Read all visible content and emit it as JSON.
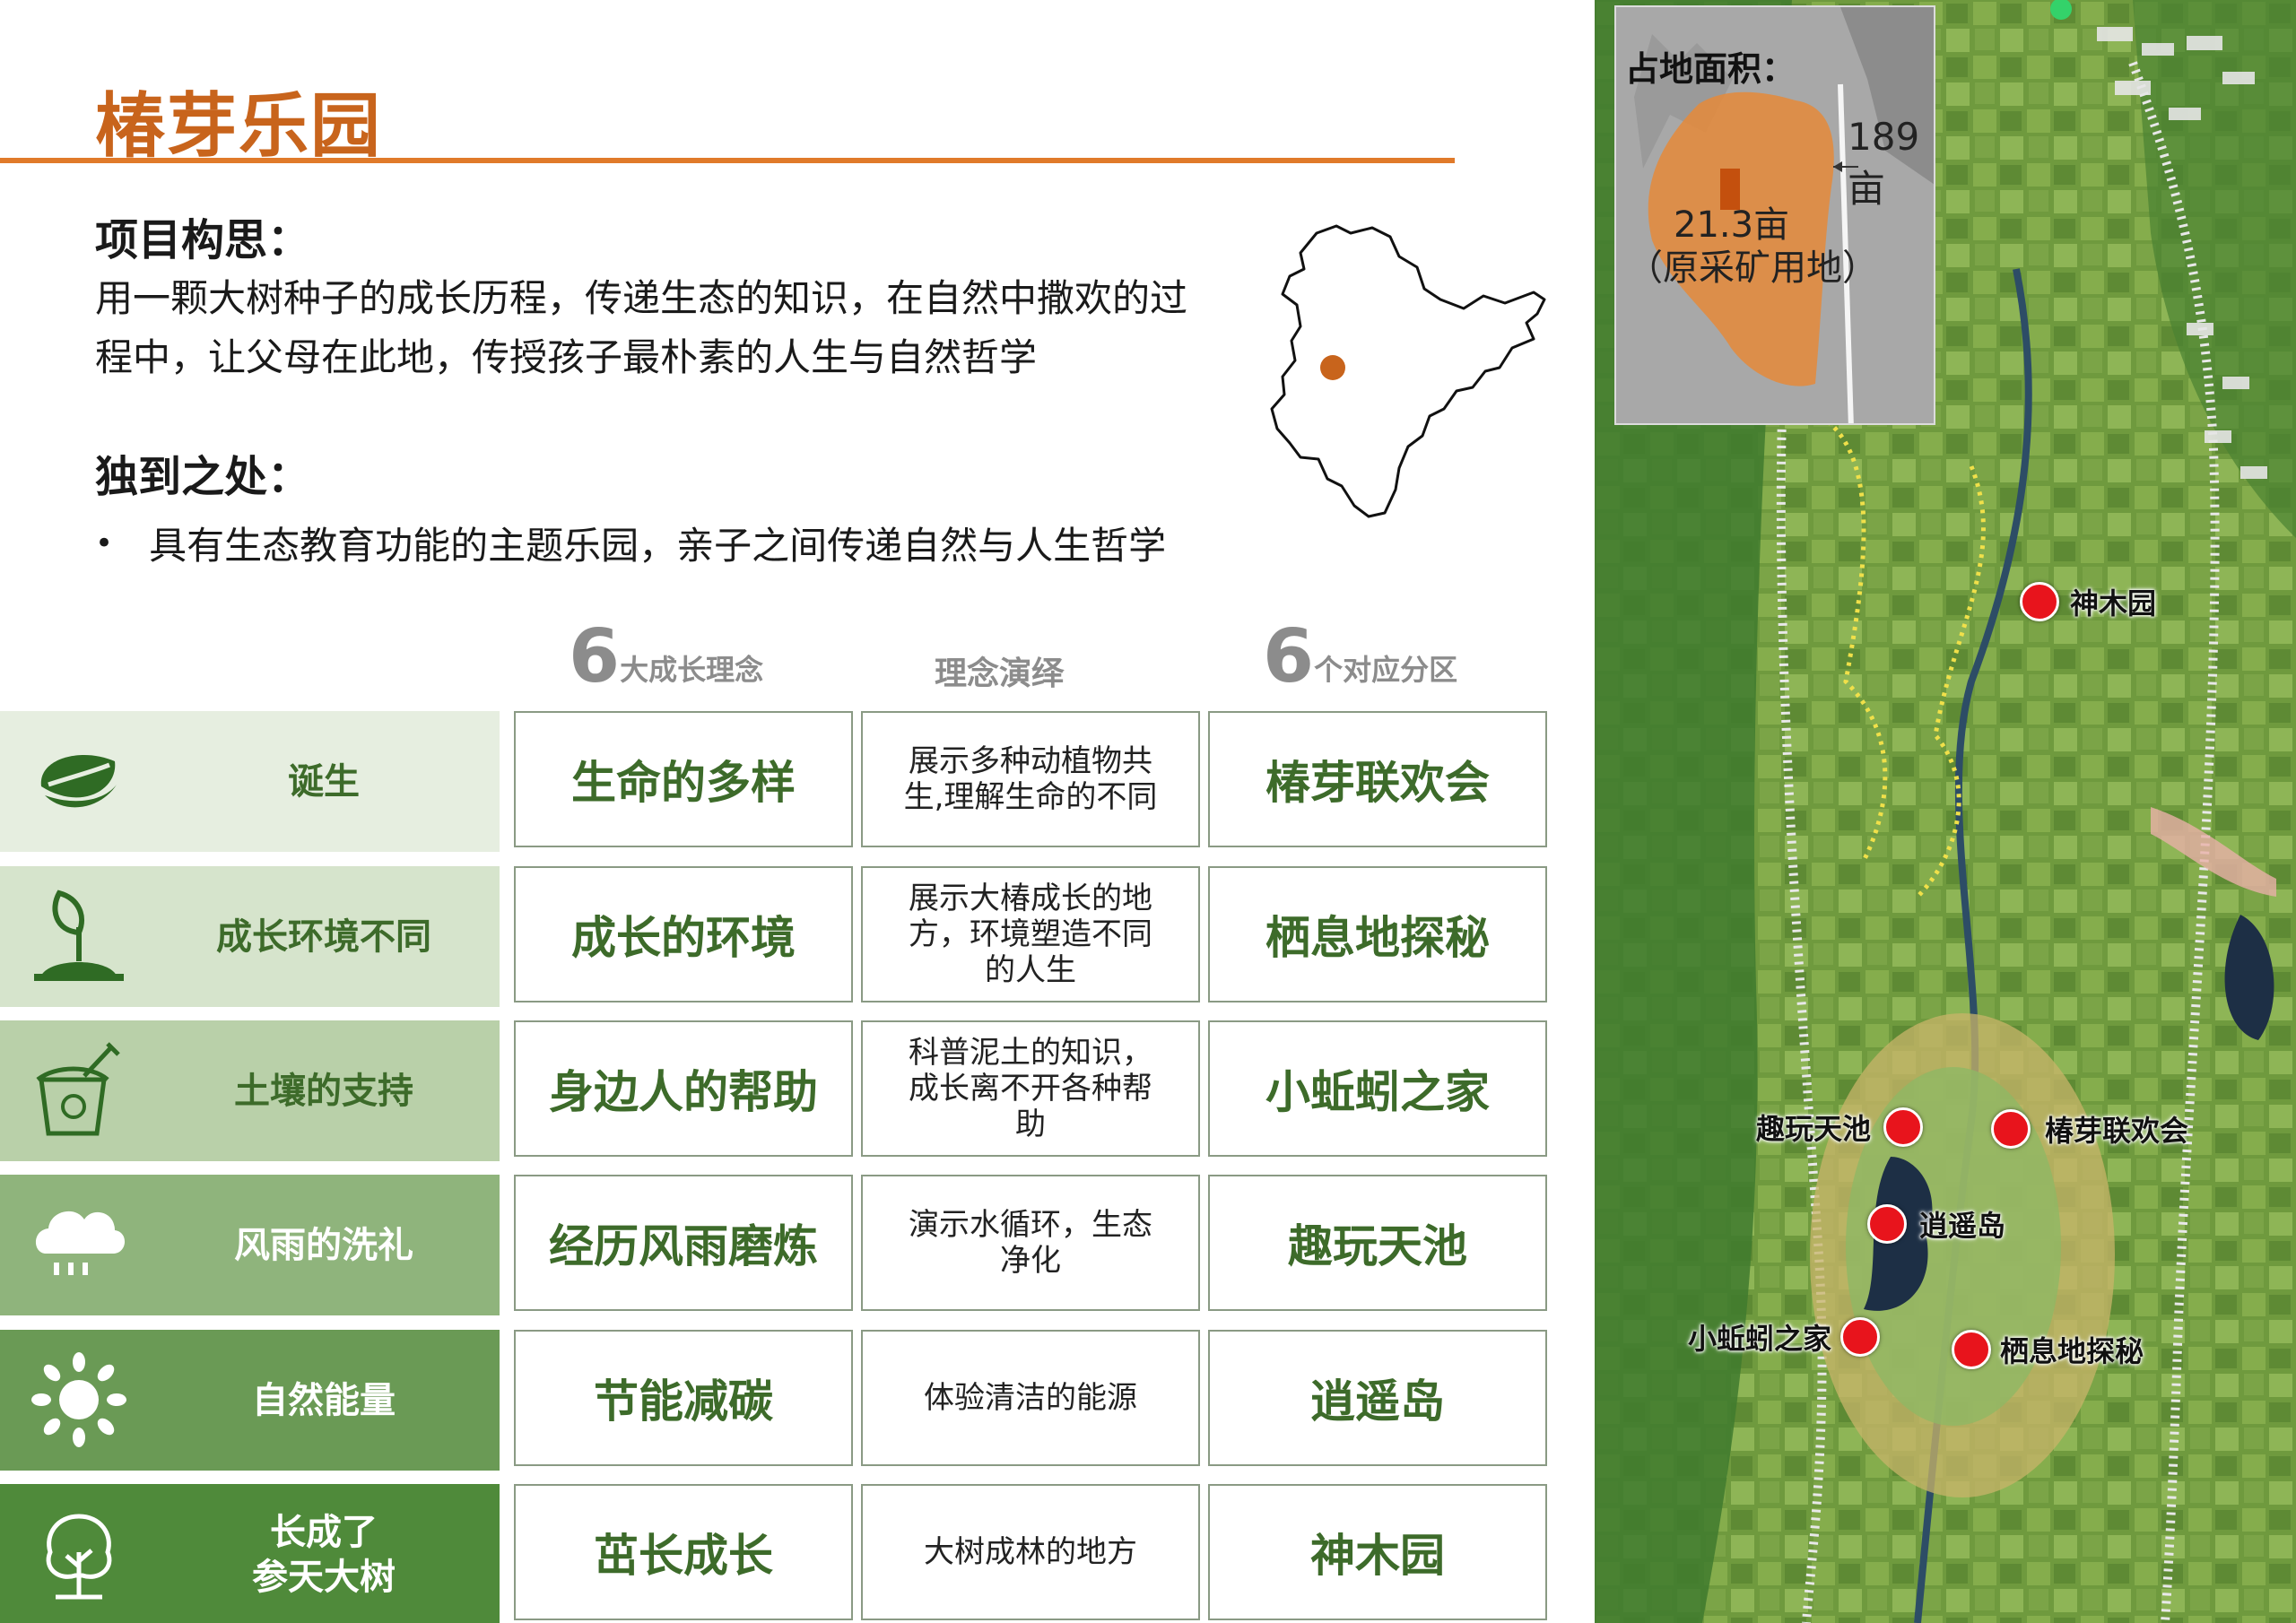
{
  "title": "椿芽乐园",
  "concept": {
    "heading": "项目构思：",
    "line1": "用一颗大树种子的成长历程，传递生态的知识，在自然中撒欢的过",
    "line2": "程中，让父母在此地，传授孩子最朴素的人生与自然哲学"
  },
  "unique": {
    "heading": "独到之处：",
    "bullet": "•",
    "text": "具有生态教育功能的主题乐园，亲子之间传递自然与人生哲学"
  },
  "table": {
    "headers": [
      {
        "number": "6",
        "text": "大成长理念"
      },
      {
        "text": "理念演绎"
      },
      {
        "number": "6",
        "text": "个对应分区"
      }
    ],
    "rows": [
      {
        "icon": "seed-icon",
        "label": "诞生",
        "concept": "生命的多样",
        "interpretation": "展示多种动植物共生,理解生命的不同",
        "zone": "椿芽联欢会",
        "bg": "#e6eee0",
        "color": "#3d6b2a"
      },
      {
        "icon": "sprout-icon",
        "label": "成长环境不同",
        "concept": "成长的环境",
        "interpretation": "展示大椿成长的地方，环境塑造不同的人生",
        "zone": "栖息地探秘",
        "bg": "#d6e4cc",
        "color": "#3d6b2a"
      },
      {
        "icon": "bucket-icon",
        "label": "土壤的支持",
        "concept": "身边人的帮助",
        "interpretation": "科普泥土的知识，成长离不开各种帮助",
        "zone": "小蚯蚓之家",
        "bg": "#b9d0a9",
        "color": "#3d6b2a"
      },
      {
        "icon": "cloud-rain-icon",
        "label": "风雨的洗礼",
        "concept": "经历风雨磨炼",
        "interpretation": "演示水循环，生态净化",
        "zone": "趣玩天池",
        "bg": "#8fb47c",
        "color": "#ffffff"
      },
      {
        "icon": "sun-icon",
        "label": "自然能量",
        "concept": "节能减碳",
        "interpretation": "体验清洁的能源",
        "zone": "逍遥岛",
        "bg": "#6a9a55",
        "color": "#ffffff"
      },
      {
        "icon": "tree-icon",
        "label": "长成了参天大树",
        "concept": "茁长成长",
        "interpretation": "大树成林的地方",
        "zone": "神木园",
        "bg": "#4f8a3a",
        "color": "#ffffff"
      }
    ]
  },
  "map": {
    "inset_title": "占地面积：",
    "inset_total": "189亩",
    "inset_part": "21.3亩",
    "inset_note": "（原采矿用地）",
    "markers": [
      "神木园",
      "趣玩天池",
      "椿芽联欢会",
      "逍遥岛",
      "小蚯蚓之家",
      "栖息地探秘"
    ]
  },
  "colors": {
    "accent": "#e07a2a",
    "title": "#c8641c",
    "green": "#3d6b2a",
    "marker": "#e8141c"
  }
}
